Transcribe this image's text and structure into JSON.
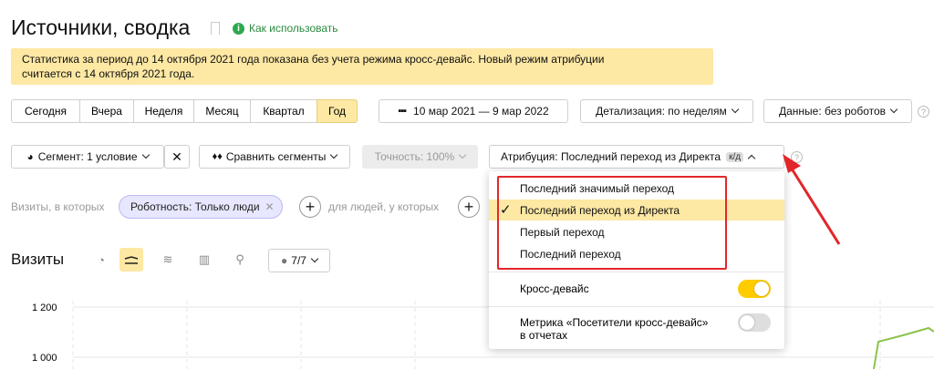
{
  "header": {
    "title": "Источники, сводка",
    "how_to_use": "Как использовать"
  },
  "notice": {
    "line1": "Статистика за период до 14 октября 2021 года показана без учета режима кросс-девайс. Новый режим атрибуции",
    "line2": "считается с 14 октября 2021 года."
  },
  "period": {
    "items": [
      "Сегодня",
      "Вчера",
      "Неделя",
      "Месяц",
      "Квартал",
      "Год"
    ],
    "active": "Год"
  },
  "date_range": "10 мар 2021 — 9 мар 2022",
  "detail": "Детализация: по неделям",
  "data_filter": "Данные: без роботов",
  "segment": "Сегмент: 1 условие",
  "compare": "Сравнить сегменты",
  "accuracy": "Точность: 100%",
  "attribution": {
    "label": "Атрибуция: Последний переход из Директа",
    "badge": "к/д"
  },
  "filters": {
    "visits_where": "Визиты, в которых",
    "chip": "Роботность: Только люди",
    "people_where": "для людей, у которых"
  },
  "visits": {
    "title": "Визиты",
    "series_count": "7/7"
  },
  "chart": {
    "y_ticks": [
      "1 200",
      "1 000"
    ]
  },
  "dropdown": {
    "options": [
      "Последний значимый переход",
      "Последний переход из Директа",
      "Первый переход",
      "Последний переход"
    ],
    "selected_index": 1,
    "cross_device_label": "Кросс-девайс",
    "cross_device_on": true,
    "metric_label_line1": "Метрика «Посетители кросс-девайс»",
    "metric_label_line2": "в отчетах",
    "metric_on": false
  },
  "colors": {
    "accent_yellow": "#fde8a4",
    "toggle_on": "#ffcc00",
    "annotation_red": "#e3262b",
    "chart_line": "#8bc34a"
  }
}
